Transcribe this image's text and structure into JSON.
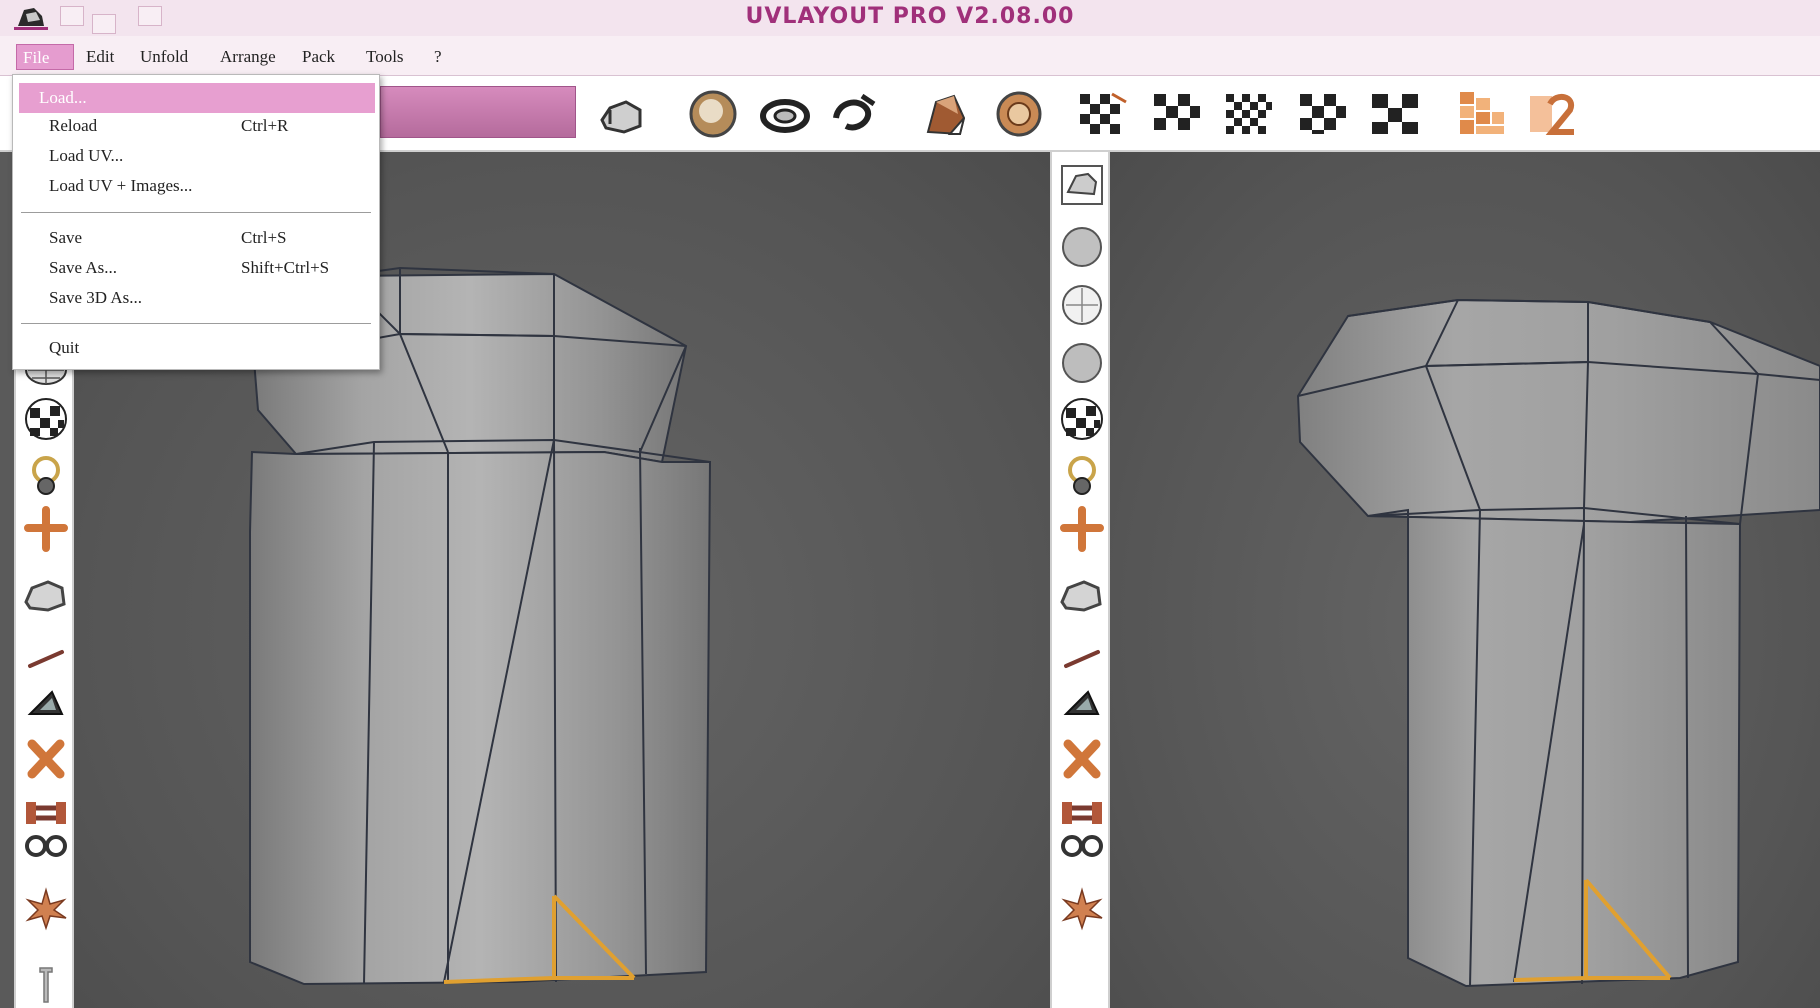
{
  "window": {
    "title": "UVLAYOUT PRO V2.08.00",
    "accent_color": "#a0307a",
    "menu_highlight_color": "#e79fd0"
  },
  "menubar": {
    "items": [
      {
        "label": "File",
        "active": true
      },
      {
        "label": "Edit"
      },
      {
        "label": "Unfold"
      },
      {
        "label": "Arrange"
      },
      {
        "label": "Pack"
      },
      {
        "label": "Tools"
      },
      {
        "label": "?"
      }
    ]
  },
  "file_menu": {
    "items": [
      {
        "label": "Load...",
        "shortcut": "",
        "highlighted": true
      },
      {
        "label": "Reload",
        "shortcut": "Ctrl+R"
      },
      {
        "label": "Load UV...",
        "shortcut": ""
      },
      {
        "label": "Load UV + Images...",
        "shortcut": ""
      },
      {
        "label": "Save",
        "shortcut": "Ctrl+S"
      },
      {
        "label": "Save As...",
        "shortcut": "Shift+Ctrl+S"
      },
      {
        "label": "Save 3D As...",
        "shortcut": ""
      },
      {
        "label": "Quit",
        "shortcut": ""
      }
    ]
  },
  "toolbar": {
    "icons": [
      "uv-head-icon",
      "sphere-icon",
      "ring-icon",
      "twist-icon",
      "shell-icon",
      "target-icon",
      "checker-mix-icon",
      "checker-fine-icon",
      "checker-medium-icon",
      "checker-coarse-icon",
      "checker-large-icon",
      "bricks-icon",
      "number-icon"
    ]
  },
  "left_toolbar": {
    "icons": [
      "mesh-sphere-icon",
      "checker-sphere-icon",
      "ring-pin-icon",
      "cross-tool-icon",
      "head-tool-icon",
      "line-tool-icon",
      "triangle-tool-icon",
      "x-tool-icon",
      "pipe-tool-icon",
      "glasses-tool-icon",
      "splash-tool-icon"
    ]
  },
  "right_toolbar": {
    "icons": [
      "view-box-icon",
      "sphere-solid-icon",
      "sphere-outline-icon",
      "sphere-flat-icon",
      "checker-sphere-icon",
      "ring-pin-icon",
      "cross-tool-icon",
      "head-tool-icon",
      "line-tool-icon",
      "triangle-tool-icon",
      "x-tool-icon",
      "pipe-tool-icon",
      "glasses-tool-icon",
      "splash-tool-icon"
    ]
  }
}
